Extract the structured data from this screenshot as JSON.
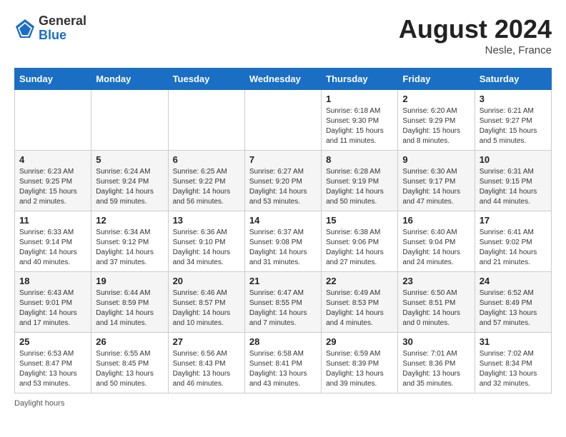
{
  "header": {
    "logo_general": "General",
    "logo_blue": "Blue",
    "month_year": "August 2024",
    "location": "Nesle, France"
  },
  "weekdays": [
    "Sunday",
    "Monday",
    "Tuesday",
    "Wednesday",
    "Thursday",
    "Friday",
    "Saturday"
  ],
  "weeks": [
    [
      {
        "day": "",
        "info": ""
      },
      {
        "day": "",
        "info": ""
      },
      {
        "day": "",
        "info": ""
      },
      {
        "day": "",
        "info": ""
      },
      {
        "day": "1",
        "info": "Sunrise: 6:18 AM\nSunset: 9:30 PM\nDaylight: 15 hours\nand 11 minutes."
      },
      {
        "day": "2",
        "info": "Sunrise: 6:20 AM\nSunset: 9:29 PM\nDaylight: 15 hours\nand 8 minutes."
      },
      {
        "day": "3",
        "info": "Sunrise: 6:21 AM\nSunset: 9:27 PM\nDaylight: 15 hours\nand 5 minutes."
      }
    ],
    [
      {
        "day": "4",
        "info": "Sunrise: 6:23 AM\nSunset: 9:25 PM\nDaylight: 15 hours\nand 2 minutes."
      },
      {
        "day": "5",
        "info": "Sunrise: 6:24 AM\nSunset: 9:24 PM\nDaylight: 14 hours\nand 59 minutes."
      },
      {
        "day": "6",
        "info": "Sunrise: 6:25 AM\nSunset: 9:22 PM\nDaylight: 14 hours\nand 56 minutes."
      },
      {
        "day": "7",
        "info": "Sunrise: 6:27 AM\nSunset: 9:20 PM\nDaylight: 14 hours\nand 53 minutes."
      },
      {
        "day": "8",
        "info": "Sunrise: 6:28 AM\nSunset: 9:19 PM\nDaylight: 14 hours\nand 50 minutes."
      },
      {
        "day": "9",
        "info": "Sunrise: 6:30 AM\nSunset: 9:17 PM\nDaylight: 14 hours\nand 47 minutes."
      },
      {
        "day": "10",
        "info": "Sunrise: 6:31 AM\nSunset: 9:15 PM\nDaylight: 14 hours\nand 44 minutes."
      }
    ],
    [
      {
        "day": "11",
        "info": "Sunrise: 6:33 AM\nSunset: 9:14 PM\nDaylight: 14 hours\nand 40 minutes."
      },
      {
        "day": "12",
        "info": "Sunrise: 6:34 AM\nSunset: 9:12 PM\nDaylight: 14 hours\nand 37 minutes."
      },
      {
        "day": "13",
        "info": "Sunrise: 6:36 AM\nSunset: 9:10 PM\nDaylight: 14 hours\nand 34 minutes."
      },
      {
        "day": "14",
        "info": "Sunrise: 6:37 AM\nSunset: 9:08 PM\nDaylight: 14 hours\nand 31 minutes."
      },
      {
        "day": "15",
        "info": "Sunrise: 6:38 AM\nSunset: 9:06 PM\nDaylight: 14 hours\nand 27 minutes."
      },
      {
        "day": "16",
        "info": "Sunrise: 6:40 AM\nSunset: 9:04 PM\nDaylight: 14 hours\nand 24 minutes."
      },
      {
        "day": "17",
        "info": "Sunrise: 6:41 AM\nSunset: 9:02 PM\nDaylight: 14 hours\nand 21 minutes."
      }
    ],
    [
      {
        "day": "18",
        "info": "Sunrise: 6:43 AM\nSunset: 9:01 PM\nDaylight: 14 hours\nand 17 minutes."
      },
      {
        "day": "19",
        "info": "Sunrise: 6:44 AM\nSunset: 8:59 PM\nDaylight: 14 hours\nand 14 minutes."
      },
      {
        "day": "20",
        "info": "Sunrise: 6:46 AM\nSunset: 8:57 PM\nDaylight: 14 hours\nand 10 minutes."
      },
      {
        "day": "21",
        "info": "Sunrise: 6:47 AM\nSunset: 8:55 PM\nDaylight: 14 hours\nand 7 minutes."
      },
      {
        "day": "22",
        "info": "Sunrise: 6:49 AM\nSunset: 8:53 PM\nDaylight: 14 hours\nand 4 minutes."
      },
      {
        "day": "23",
        "info": "Sunrise: 6:50 AM\nSunset: 8:51 PM\nDaylight: 14 hours\nand 0 minutes."
      },
      {
        "day": "24",
        "info": "Sunrise: 6:52 AM\nSunset: 8:49 PM\nDaylight: 13 hours\nand 57 minutes."
      }
    ],
    [
      {
        "day": "25",
        "info": "Sunrise: 6:53 AM\nSunset: 8:47 PM\nDaylight: 13 hours\nand 53 minutes."
      },
      {
        "day": "26",
        "info": "Sunrise: 6:55 AM\nSunset: 8:45 PM\nDaylight: 13 hours\nand 50 minutes."
      },
      {
        "day": "27",
        "info": "Sunrise: 6:56 AM\nSunset: 8:43 PM\nDaylight: 13 hours\nand 46 minutes."
      },
      {
        "day": "28",
        "info": "Sunrise: 6:58 AM\nSunset: 8:41 PM\nDaylight: 13 hours\nand 43 minutes."
      },
      {
        "day": "29",
        "info": "Sunrise: 6:59 AM\nSunset: 8:39 PM\nDaylight: 13 hours\nand 39 minutes."
      },
      {
        "day": "30",
        "info": "Sunrise: 7:01 AM\nSunset: 8:36 PM\nDaylight: 13 hours\nand 35 minutes."
      },
      {
        "day": "31",
        "info": "Sunrise: 7:02 AM\nSunset: 8:34 PM\nDaylight: 13 hours\nand 32 minutes."
      }
    ]
  ],
  "footer": "Daylight hours"
}
